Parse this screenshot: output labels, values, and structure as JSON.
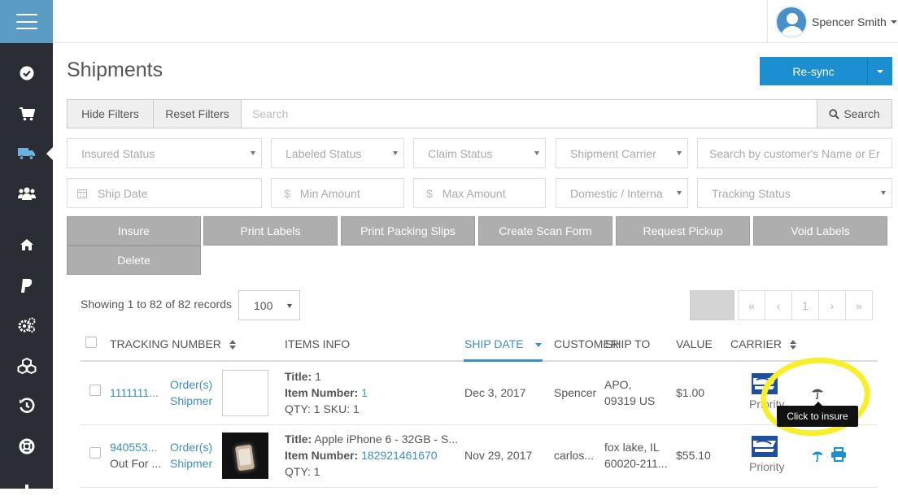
{
  "colors": {
    "accent": "#1c8fd0",
    "sidebar": "#2a2d33",
    "hamburger": "#5b9cc4",
    "highlight": "#f7ef2a",
    "link": "#3d8fc4"
  },
  "sidebar": {
    "items": [
      {
        "icon": "check-circle-icon"
      },
      {
        "icon": "cart-icon"
      },
      {
        "icon": "truck-icon",
        "active": true
      },
      {
        "icon": "users-icon"
      },
      {
        "icon": "home-icon"
      },
      {
        "icon": "paypal-icon"
      },
      {
        "icon": "gears-icon"
      },
      {
        "icon": "cubes-icon"
      },
      {
        "icon": "history-icon"
      },
      {
        "icon": "life-ring-icon"
      }
    ]
  },
  "user": {
    "name": "Spencer Smith"
  },
  "page": {
    "title": "Shipments"
  },
  "resync": {
    "label": "Re-sync"
  },
  "filters": {
    "hide_label": "Hide Filters",
    "reset_label": "Reset Filters",
    "search_placeholder": "Search",
    "search_button": "Search",
    "insured_status": "Insured Status",
    "labeled_status": "Labeled Status",
    "claim_status": "Claim Status",
    "shipment_carrier": "Shipment Carrier",
    "customer_search": "Search by customer's Name or Er",
    "ship_date": "Ship Date",
    "min_amount": "Min Amount",
    "max_amount": "Max Amount",
    "domestic": "Domestic / Interna",
    "tracking_status": "Tracking Status",
    "currency_symbol": "$"
  },
  "actions": {
    "insure": "Insure",
    "print_labels": "Print Labels",
    "print_packing_slips": "Print Packing Slips",
    "create_scan_form": "Create Scan Form",
    "request_pickup": "Request Pickup",
    "void_labels": "Void Labels",
    "delete": "Delete"
  },
  "listing": {
    "showing": "Showing 1 to 82 of 82 records",
    "page_size": "100",
    "pager": {
      "first": "«",
      "prev": "‹",
      "current": "1",
      "next": "›",
      "last": "»"
    }
  },
  "table": {
    "headers": {
      "tracking": "TRACKING NUMBER",
      "items": "ITEMS INFO",
      "ship_date": "SHIP DATE",
      "customer": "CUSTOMER",
      "ship_to": "SHIP TO",
      "value": "VALUE",
      "carrier": "CARRIER"
    },
    "rows": [
      {
        "tracking": "1111111...",
        "tracking_sub": "",
        "order_link": "Order(s)",
        "shipment_link": "Shipmer",
        "title_label": "Title:",
        "title": " 1",
        "item_number_label": "Item Number:",
        "item_number": " 1",
        "qty_line": "QTY: 1 SKU: 1",
        "ship_date": "Dec 3, 2017",
        "customer": "Spencer",
        "ship_to_1": "APO,",
        "ship_to_2": "09319 US",
        "value": "$1.00",
        "carrier": "Priority"
      },
      {
        "tracking": "940553...",
        "tracking_sub": "Out For ...",
        "order_link": "Order(s)",
        "shipment_link": "Shipmer",
        "title_label": "Title:",
        "title": " Apple iPhone 6 - 32GB - S...",
        "item_number_label": "Item Number:",
        "item_number": " 182921461670",
        "qty_line": "QTY: 1",
        "ship_date": "Nov 29, 2017",
        "customer": "carlos...",
        "ship_to_1": "fox lake, IL",
        "ship_to_2": "60020-211...",
        "value": "$55.10",
        "carrier": "Priority"
      }
    ]
  },
  "tooltip": {
    "text": "Click to insure"
  }
}
